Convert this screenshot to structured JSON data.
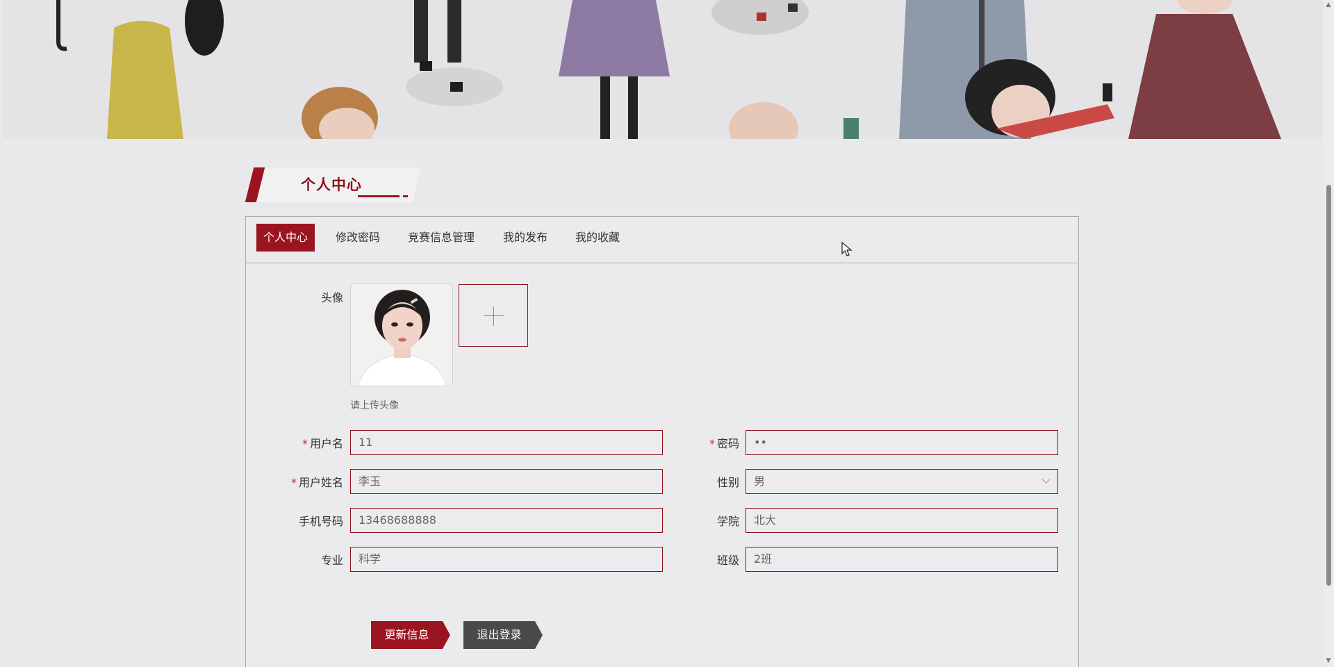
{
  "section_title": "个人中心",
  "tabs": [
    {
      "label": "个人中心",
      "active": true
    },
    {
      "label": "修改密码",
      "active": false
    },
    {
      "label": "竞赛信息管理",
      "active": false
    },
    {
      "label": "我的发布",
      "active": false
    },
    {
      "label": "我的收藏",
      "active": false
    }
  ],
  "avatar": {
    "label": "头像",
    "hint": "请上传头像"
  },
  "form": {
    "username": {
      "label": "用户名",
      "required": true,
      "value": "11"
    },
    "password": {
      "label": "密码",
      "required": true,
      "value": "••"
    },
    "realname": {
      "label": "用户姓名",
      "required": true,
      "value": "李玉"
    },
    "gender": {
      "label": "性别",
      "required": false,
      "value": "男"
    },
    "phone": {
      "label": "手机号码",
      "required": false,
      "value": "13468688888"
    },
    "college": {
      "label": "学院",
      "required": false,
      "value": "北大"
    },
    "major": {
      "label": "专业",
      "required": false,
      "value": "科学"
    },
    "class": {
      "label": "班级",
      "required": false,
      "value": "2班"
    }
  },
  "buttons": {
    "update": "更新信息",
    "logout": "退出登录"
  },
  "colors": {
    "accent": "#9b1520",
    "secondary_button": "#4a4a4a",
    "background": "#e9e9eb"
  },
  "icons": {
    "upload": "plus-icon",
    "select": "chevron-down-icon",
    "cursor": "mouse-pointer-icon"
  }
}
